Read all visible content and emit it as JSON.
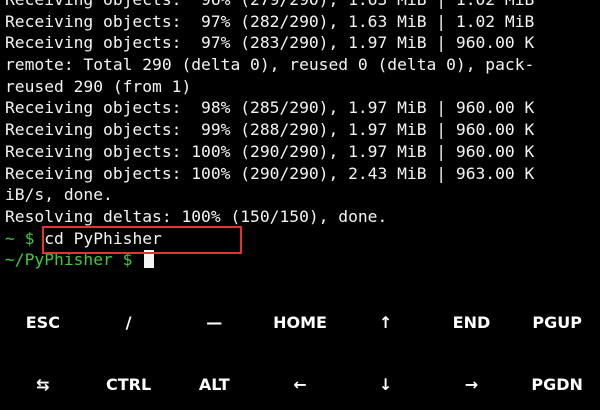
{
  "terminal": {
    "lines": [
      "Receiving objects:  96% (279/290), 1.63 MiB | 1.02 MiB",
      "Receiving objects:  97% (282/290), 1.63 MiB | 1.02 MiB",
      "Receiving objects:  97% (283/290), 1.97 MiB | 960.00 K",
      "remote: Total 290 (delta 0), reused 0 (delta 0), pack-",
      "reused 290 (from 1)",
      "Receiving objects:  98% (285/290), 1.97 MiB | 960.00 K",
      "Receiving objects:  99% (288/290), 1.97 MiB | 960.00 K",
      "Receiving objects: 100% (290/290), 1.97 MiB | 960.00 K",
      "Receiving objects: 100% (290/290), 2.43 MiB | 963.00 K",
      "iB/s, done.",
      "Resolving deltas: 100% (150/150), done."
    ],
    "command_prompt": "~ $ ",
    "command_text": "cd PyPhisher",
    "current_prompt": "~/PyPhisher $ "
  },
  "extra_keys": {
    "row1": [
      "ESC",
      "/",
      "—",
      "HOME",
      "↑",
      "END",
      "PGUP"
    ],
    "row2": [
      "⇆",
      "CTRL",
      "ALT",
      "←",
      "↓",
      "→",
      "PGDN"
    ]
  },
  "colors": {
    "prompt_green": "#3ec93e",
    "highlight_red": "#e1342d",
    "text": "#f4f4f4",
    "background": "#000000"
  }
}
